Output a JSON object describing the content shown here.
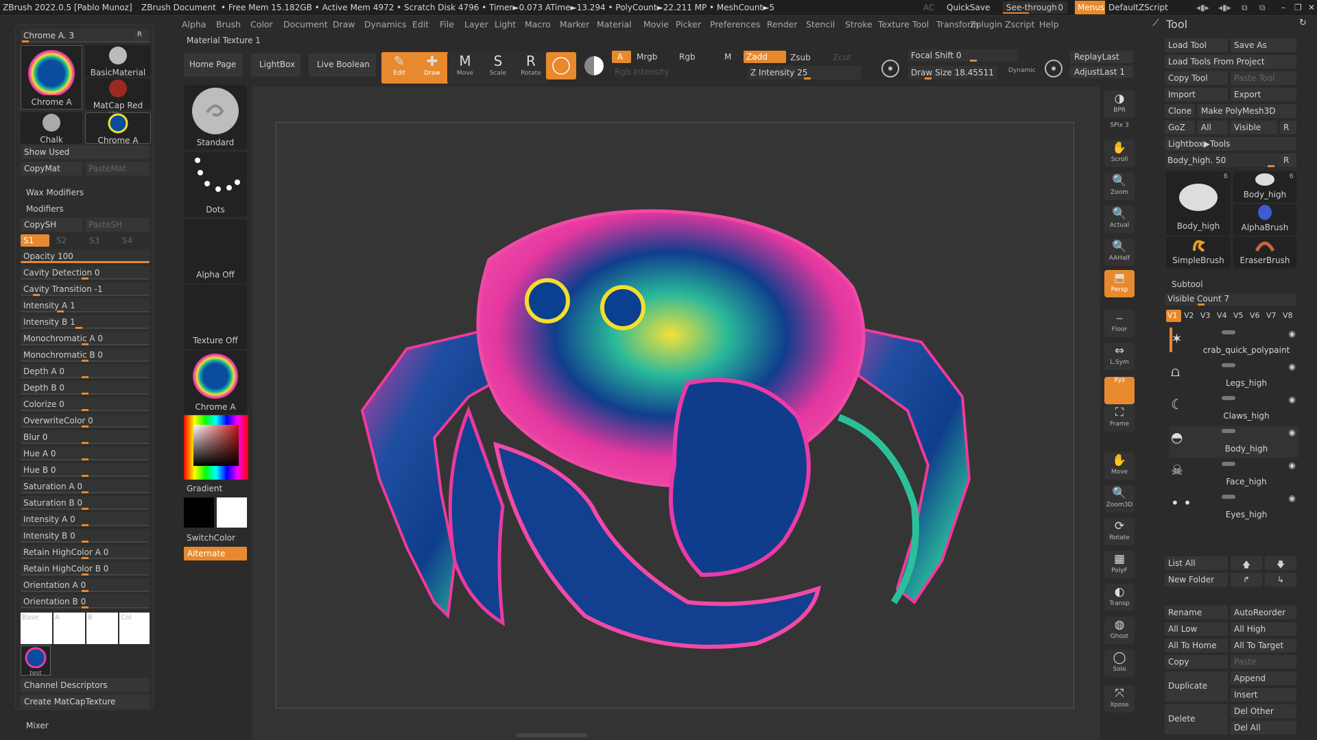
{
  "title_bar": {
    "app": "ZBrush 2022.0.5 [Pablo Munoz]",
    "doc": "ZBrush Document",
    "stats": "• Free Mem 15.182GB • Active Mem 4972 • Scratch Disk 4796 • Timer►0.073 ATime►13.294 • PolyCount►22.211 MP • MeshCount►5",
    "ac": "AC",
    "quicksave": "QuickSave",
    "see_through_label": "See-through",
    "see_through_value": "0",
    "menus": "Menus",
    "script": "DefaultZScript"
  },
  "menu_items": [
    "Alpha",
    "Brush",
    "Color",
    "Document",
    "Draw",
    "Dynamics",
    "Edit",
    "File",
    "Layer",
    "Light",
    "Macro",
    "Marker",
    "Material",
    "Movie",
    "Picker",
    "Preferences",
    "Render",
    "Stencil",
    "Stroke",
    "Texture",
    "Tool",
    "Transform",
    "Zplugin",
    "Zscript",
    "Help"
  ],
  "left": {
    "material_label": "Chrome A. 3",
    "r": "R",
    "materials": [
      "Chrome A",
      "BasicMaterial",
      "MatCap Red Wax",
      "Chalk",
      "Chrome A"
    ],
    "show_used": "Show Used",
    "copymat": "CopyMat",
    "pastemat": "PasteMat",
    "wax_modifiers": "Wax Modifiers",
    "modifiers": "Modifiers",
    "copysh": "CopySH",
    "pastesh": "PasteSH",
    "s_tabs": [
      "S1",
      "S2",
      "S3",
      "S4"
    ],
    "sliders": [
      {
        "label": "Opacity 100",
        "fill": 1.0
      },
      {
        "label": "Cavity Detection 0",
        "fill": 0.5
      },
      {
        "label": "Cavity Transition -1",
        "fill": 0.1
      },
      {
        "label": "Intensity A 1",
        "fill": 0.3
      },
      {
        "label": "Intensity B 1",
        "fill": 0.45
      },
      {
        "label": "Monochromatic A 0",
        "fill": 0.5
      },
      {
        "label": "Monochromatic B 0",
        "fill": 0.5
      },
      {
        "label": "Depth A 0",
        "fill": 0.5
      },
      {
        "label": "Depth B 0",
        "fill": 0.5
      },
      {
        "label": "Colorize 0",
        "fill": 0.5
      },
      {
        "label": "OverwriteColor 0",
        "fill": 0.5
      },
      {
        "label": "Blur 0",
        "fill": 0.5
      },
      {
        "label": "Hue A 0",
        "fill": 0.5
      },
      {
        "label": "Hue B 0",
        "fill": 0.5
      },
      {
        "label": "Saturation A 0",
        "fill": 0.5
      },
      {
        "label": "Saturation B 0",
        "fill": 0.5
      },
      {
        "label": "Intensity A 0",
        "fill": 0.5
      },
      {
        "label": "Intensity B 0",
        "fill": 0.5
      },
      {
        "label": "Retain HighColor A 0",
        "fill": 0.5
      },
      {
        "label": "Retain HighColor B 0",
        "fill": 0.5
      },
      {
        "label": "Orientation A 0",
        "fill": 0.5
      },
      {
        "label": "Orientation B 0",
        "fill": 0.5
      }
    ],
    "swatch_labels": [
      "Base",
      "A",
      "B",
      "Col"
    ],
    "test_label": "test",
    "channel_descriptors": "Channel Descriptors",
    "create_matcap": "Create MatCapTexture",
    "mixer": "Mixer"
  },
  "brush_column": {
    "material_texture": "Material Texture 1",
    "items": [
      "Standard",
      "Dots",
      "Alpha Off",
      "Texture Off",
      "Chrome A"
    ],
    "gradient": "Gradient",
    "switchcolor": "SwitchColor",
    "alternate": "Alternate"
  },
  "top_toolbar": {
    "home": "Home Page",
    "lightbox": "LightBox",
    "live_boolean": "Live Boolean",
    "tools": [
      "Edit",
      "Draw",
      "Move",
      "Scale",
      "Rotate"
    ],
    "a": "A",
    "mrgb": "Mrgb",
    "rgb": "Rgb",
    "m": "M",
    "rgb_intensity": "Rgb Intensity",
    "zadd": "Zadd",
    "zsub": "Zsub",
    "zcut": "Zcut",
    "z_intensity": "Z Intensity 25",
    "focal_shift": "Focal Shift 0",
    "draw_size": "Draw Size 18.45511",
    "dynamic": "Dynamic",
    "replay_last": "ReplayLast",
    "adjust_last": "AdjustLast 1"
  },
  "right_shelf": [
    "BPR",
    "SPix 3",
    "Scroll",
    "Zoom",
    "Actual",
    "AAHalf",
    "Persp",
    "Floor",
    "L.Sym",
    "Xyz",
    "Frame",
    "Move",
    "Zoom3D",
    "Rotate",
    "PolyF",
    "Transp",
    "Ghost",
    "Solo",
    "Xpose"
  ],
  "tool_panel": {
    "title": "Tool",
    "load_tool": "Load Tool",
    "save_as": "Save As",
    "load_from_project": "Load Tools From Project",
    "copy_tool": "Copy Tool",
    "paste_tool": "Paste Tool",
    "import": "Import",
    "export": "Export",
    "clone": "Clone",
    "make_polymesh": "Make PolyMesh3D",
    "goz": "GoZ",
    "all": "All",
    "visible": "Visible",
    "r": "R",
    "lightbox_tools": "Lightbox▶Tools",
    "body_high_slider": "Body_high. 50",
    "thumbs": [
      {
        "name": "Body_high",
        "count": "6"
      },
      {
        "name": "Body_high",
        "count": "6"
      },
      {
        "name": "AlphaBrush",
        "count": ""
      },
      {
        "name": "SimpleBrush",
        "count": ""
      },
      {
        "name": "EraserBrush",
        "count": ""
      }
    ],
    "subtool": "Subtool",
    "visible_count": "Visible Count 7",
    "v_tabs": [
      "V1",
      "V2",
      "V3",
      "V4",
      "V5",
      "V6",
      "V7",
      "V8"
    ],
    "subtools": [
      "crab_quick_polypaint",
      "Legs_high",
      "Claws_high",
      "Body_high",
      "Face_high",
      "Eyes_high"
    ],
    "list_all": "List All",
    "new_folder": "New Folder",
    "rename": "Rename",
    "autoreorder": "AutoReorder",
    "all_low": "All Low",
    "all_high": "All High",
    "all_to_home": "All To Home",
    "all_to_target": "All To Target",
    "copy": "Copy",
    "paste": "Paste",
    "duplicate": "Duplicate",
    "append": "Append",
    "insert": "Insert",
    "delete": "Delete",
    "del_other": "Del Other",
    "del_all": "Del All"
  },
  "colors": {
    "accent": "#e8892e",
    "bg": "#2b2b2b",
    "panel": "#2d2d2d"
  }
}
